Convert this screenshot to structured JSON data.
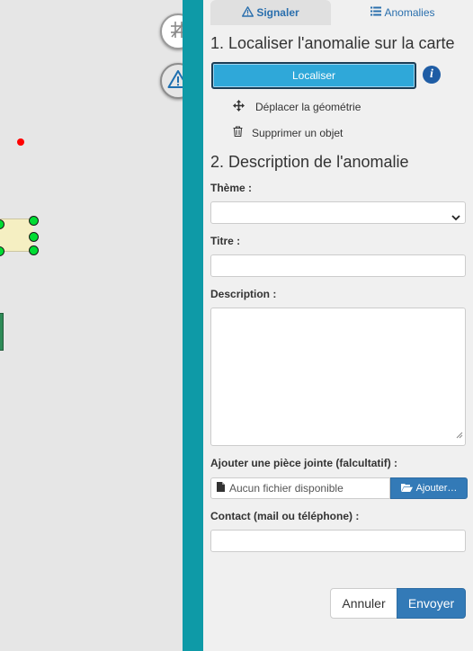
{
  "map": {
    "buttons": [
      {
        "name": "measure-tool-icon"
      },
      {
        "name": "warning-icon"
      }
    ]
  },
  "tabs": {
    "signaler": {
      "label": "Signaler",
      "icon": "warning-icon"
    },
    "anomalies": {
      "label": "Anomalies",
      "icon": "list-icon"
    }
  },
  "section1": {
    "title": "1. Localiser l'anomalie sur la carte",
    "localiser_label": "Localiser",
    "info_icon": "i",
    "tools": [
      {
        "label": "Déplacer la géométrie",
        "icon": "move-icon"
      },
      {
        "label": "Supprimer un objet",
        "icon": "trash-icon"
      }
    ]
  },
  "section2": {
    "title": "2. Description de l'anomalie",
    "theme_label": "Thème :",
    "theme_value": "",
    "titre_label": "Titre :",
    "titre_value": "",
    "description_label": "Description :",
    "description_value": "",
    "attachment_label": "Ajouter une pièce jointe (falcultatif) :",
    "attachment_status": "Aucun fichier disponible",
    "attachment_button": "Ajouter…",
    "contact_label": "Contact (mail ou téléphone) :",
    "contact_value": ""
  },
  "actions": {
    "cancel_label": "Annuler",
    "submit_label": "Envoyer"
  },
  "colors": {
    "accent": "#0e9aa7",
    "primary_button": "#337ab7",
    "localiser_button": "#2fa8d9",
    "tab_text": "#2a6fad"
  }
}
